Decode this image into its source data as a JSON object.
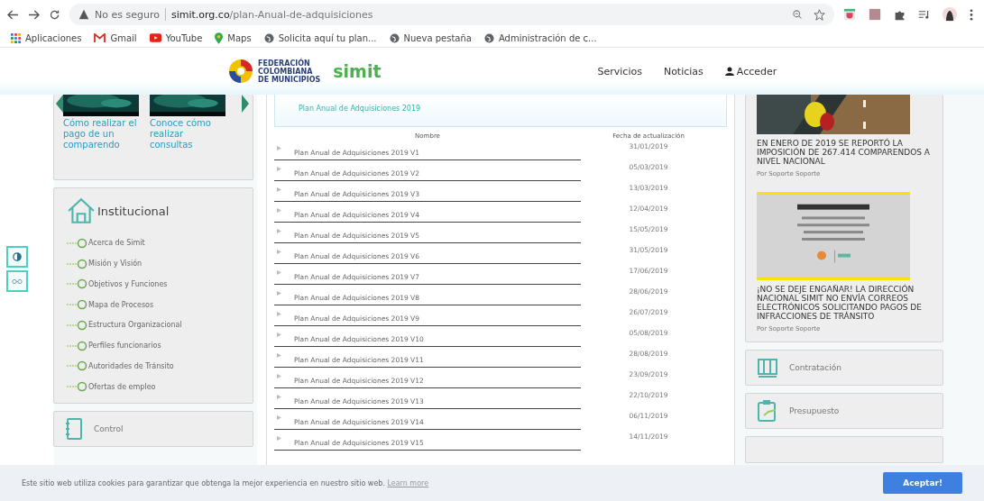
{
  "browser": {
    "security": "No es seguro",
    "url_host": "simit.org.co",
    "url_path": "/plan-Anual-de-adquisiciones",
    "bookmarks": [
      {
        "label": "Aplicaciones",
        "kind": "apps"
      },
      {
        "label": "Gmail",
        "kind": "gmail"
      },
      {
        "label": "YouTube",
        "kind": "youtube"
      },
      {
        "label": "Maps",
        "kind": "maps"
      },
      {
        "label": "Solicita aquí tu plan...",
        "kind": "globe"
      },
      {
        "label": "Nueva pestaña",
        "kind": "globe"
      },
      {
        "label": "Administración de c...",
        "kind": "globe"
      }
    ]
  },
  "header": {
    "logo_lines": [
      "FEDERACIÓN",
      "COLOMBIANA",
      "DE MUNICIPIOS"
    ],
    "brand": "simit",
    "nav": [
      {
        "label": "Servicios",
        "kind": "text"
      },
      {
        "label": "Noticias",
        "kind": "text"
      },
      {
        "label": "Acceder",
        "kind": "user"
      }
    ]
  },
  "left": {
    "videos": [
      {
        "caption": "Cómo realizar el pago de un comparendo"
      },
      {
        "caption": "Conoce cómo realizar consultas"
      }
    ],
    "institutional": {
      "title": "Institucional",
      "items": [
        "Acerca de Simit",
        "Misión y Visión",
        "Objetivos y Funciones",
        "Mapa de Procesos",
        "Estructura Organizacional",
        "Perfiles funcionarios",
        "Autoridades de Tránsito",
        "Ofertas de empleo"
      ]
    },
    "sections": [
      {
        "label": "Control"
      }
    ]
  },
  "center": {
    "title": "Plan Anual de Adquisiciones 2019",
    "columns": [
      "Nombre",
      "Fecha de actualización"
    ],
    "rows": [
      {
        "name": "Plan Anual de Adquisiciones 2019 V1",
        "date": "31/01/2019"
      },
      {
        "name": "Plan Anual de Adquisiciones 2019 V2",
        "date": "05/03/2019"
      },
      {
        "name": "Plan Anual de Adquisiciones 2019 V3",
        "date": "13/03/2019"
      },
      {
        "name": "Plan Anual de Adquisiciones 2019 V4",
        "date": "12/04/2019"
      },
      {
        "name": "Plan Anual de Adquisiciones 2019 V5",
        "date": "15/05/2019"
      },
      {
        "name": "Plan Anual de Adquisiciones 2019 V6",
        "date": "31/05/2019"
      },
      {
        "name": "Plan Anual de Adquisiciones 2019 V7",
        "date": "17/06/2019"
      },
      {
        "name": "Plan Anual de Adquisiciones 2019 V8",
        "date": "28/06/2019"
      },
      {
        "name": "Plan Anual de Adquisiciones 2019 V9",
        "date": "26/07/2019"
      },
      {
        "name": "Plan Anual de Adquisiciones 2019 V10",
        "date": "05/08/2019"
      },
      {
        "name": "Plan Anual de Adquisiciones 2019 V11",
        "date": "28/08/2019"
      },
      {
        "name": "Plan Anual de Adquisiciones 2019 V12",
        "date": "23/09/2019"
      },
      {
        "name": "Plan Anual de Adquisiciones 2019 V13",
        "date": "22/10/2019"
      },
      {
        "name": "Plan Anual de Adquisiciones 2019 V14",
        "date": "06/11/2019"
      },
      {
        "name": "Plan Anual de Adquisiciones 2019 V15",
        "date": "14/11/2019"
      }
    ]
  },
  "right": {
    "news": [
      {
        "headline": "EN ENERO DE 2019 SE REPORTÓ LA IMPOSICIÓN DE 267.414 COMPARENDOS A NIVEL NACIONAL",
        "author": "Por Soporte Soporte"
      },
      {
        "headline": "¡NO SE DEJE ENGAÑAR! LA DIRECCIÓN NACIONAL SIMIT NO ENVÍA CORREOS ELECTRÓNICOS SOLICITANDO PAGOS DE INFRACCIONES DE TRÁNSITO",
        "author": "Por Soporte Soporte"
      }
    ],
    "sections": [
      {
        "label": "Contratación",
        "kind": "columns"
      },
      {
        "label": "Presupuesto",
        "kind": "clipboard"
      }
    ]
  },
  "cookie": {
    "text": "Este sitio web utiliza cookies para garantizar que obtenga la mejor experiencia en nuestro sitio web.",
    "link": "Learn more",
    "button": "Aceptar!"
  }
}
